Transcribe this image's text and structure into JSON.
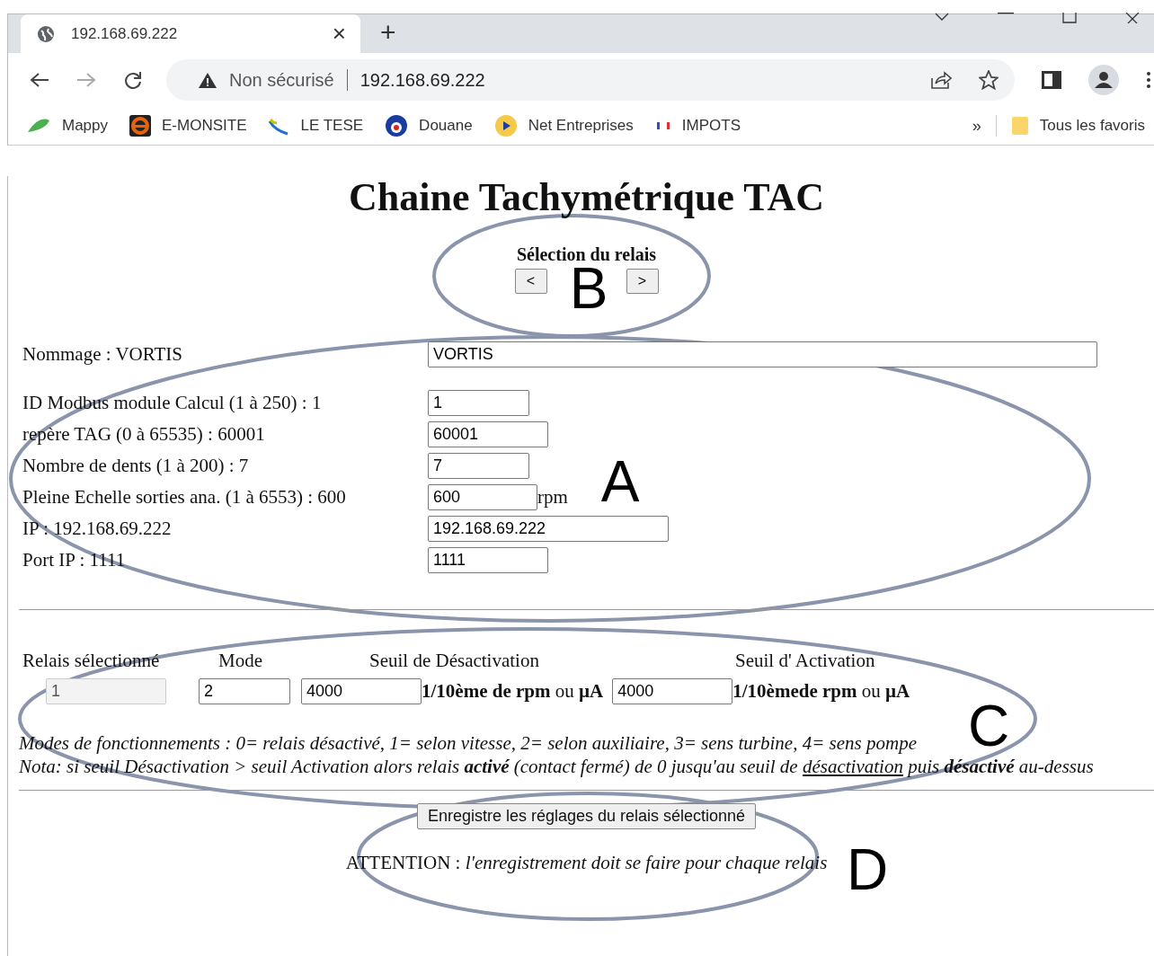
{
  "browser": {
    "tab": {
      "title": "192.168.69.222",
      "close": "×"
    },
    "new_tab": "+",
    "security": "Non sécurisé",
    "url": "192.168.69.222",
    "bookmarks": [
      {
        "label": "Mappy",
        "kind": "mappy"
      },
      {
        "label": "E-MONSITE",
        "kind": "emonsite"
      },
      {
        "label": "LE TESE",
        "kind": "tese"
      },
      {
        "label": "Douane",
        "kind": "douane"
      },
      {
        "label": "Net Entreprises",
        "kind": "net"
      },
      {
        "label": "IMPOTS",
        "kind": "impots"
      }
    ],
    "more": "»",
    "all_bookmarks": "Tous les favoris"
  },
  "page": {
    "title": "Chaine Tachymétrique TAC",
    "relay_selector": {
      "label": "Sélection du relais",
      "prev": "<",
      "next": ">"
    },
    "fields": [
      {
        "label": "Nommage : VORTIS",
        "value": "VORTIS"
      },
      {
        "label": "ID Modbus module Calcul (1 à 250) : 1",
        "value": "1"
      },
      {
        "label": "repère TAG (0 à 65535) : 60001",
        "value": "60001"
      },
      {
        "label": "Nombre de dents (1 à 200) : 7",
        "value": "7"
      },
      {
        "label": "Pleine Echelle sorties ana. (1 à 6553) : 600",
        "value": "600",
        "unit": "rpm"
      },
      {
        "label": "IP : 192.168.69.222",
        "value": "192.168.69.222"
      },
      {
        "label": "Port IP : 1111",
        "value": "1111"
      }
    ],
    "relay": {
      "headers": [
        "Relais sélectionné",
        "Mode",
        "Seuil de Désactivation",
        "Seuil d' Activation"
      ],
      "selected_relay": {
        "value": "1",
        "disabled": true
      },
      "mode": "2",
      "deactivation": "4000",
      "deactivation_unit": "**1/10ème de rpm** ou **µA**",
      "activation": "4000",
      "activation_unit": "**1/10èmede rpm** ou **µA**"
    },
    "modes_note": "Modes de fonctionnements : 0= relais désactivé, 1= selon vitesse, 2= selon auxiliaire, 3= sens turbine, 4= sens pompe",
    "nota": {
      "before": "Nota: si seuil Désactivation > seuil Activation alors relais **activé** (contact fermé) de 0 jusqu'au seuil de ",
      "underlined": "désactivation",
      "after": " puis **désactivé** au-dessus"
    },
    "save_button": "Enregistre les réglages du relais sélectionné",
    "warning": "ATTENTION : *l'enregistrement doit se faire pour chaque relais*"
  },
  "annotations": [
    {
      "letter": "B"
    },
    {
      "letter": "A"
    },
    {
      "letter": "C"
    },
    {
      "letter": "D"
    }
  ]
}
